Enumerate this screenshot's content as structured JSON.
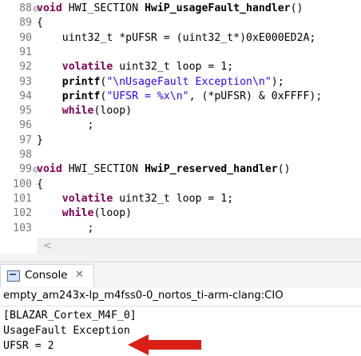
{
  "editor": {
    "lines": [
      {
        "num": "88",
        "fold": "⊖",
        "segments": [
          {
            "t": "void",
            "c": "kw"
          },
          {
            "t": " HWI_SECTION "
          },
          {
            "t": "HwiP_usageFault_handler",
            "c": "fn"
          },
          {
            "t": "()"
          }
        ]
      },
      {
        "num": "89",
        "fold": "",
        "segments": [
          {
            "t": "{"
          }
        ]
      },
      {
        "num": "90",
        "fold": "",
        "segments": [
          {
            "t": "    uint32_t *pUFSR = (uint32_t*)0xE000ED2A;"
          }
        ]
      },
      {
        "num": "91",
        "fold": "",
        "segments": []
      },
      {
        "num": "92",
        "fold": "",
        "segments": [
          {
            "t": "    "
          },
          {
            "t": "volatile",
            "c": "kw"
          },
          {
            "t": " uint32_t loop = 1;"
          }
        ]
      },
      {
        "num": "93",
        "fold": "",
        "segments": [
          {
            "t": "    "
          },
          {
            "t": "printf",
            "c": "fn"
          },
          {
            "t": "("
          },
          {
            "t": "\"\\nUsageFault Exception\\n\"",
            "c": "str"
          },
          {
            "t": ");"
          }
        ]
      },
      {
        "num": "94",
        "fold": "",
        "segments": [
          {
            "t": "    "
          },
          {
            "t": "printf",
            "c": "fn"
          },
          {
            "t": "("
          },
          {
            "t": "\"UFSR = %x\\n\"",
            "c": "str"
          },
          {
            "t": ", (*pUFSR) & 0xFFFF);"
          }
        ]
      },
      {
        "num": "95",
        "fold": "",
        "segments": [
          {
            "t": "    "
          },
          {
            "t": "while",
            "c": "kw"
          },
          {
            "t": "(loop)"
          }
        ]
      },
      {
        "num": "96",
        "fold": "",
        "segments": [
          {
            "t": "        ;"
          }
        ]
      },
      {
        "num": "97",
        "fold": "",
        "segments": [
          {
            "t": "}"
          }
        ]
      },
      {
        "num": "98",
        "fold": "",
        "segments": []
      },
      {
        "num": "99",
        "fold": "⊖",
        "segments": [
          {
            "t": "void",
            "c": "kw"
          },
          {
            "t": " HWI_SECTION "
          },
          {
            "t": "HwiP_reserved_handler",
            "c": "fn"
          },
          {
            "t": "()"
          }
        ]
      },
      {
        "num": "100",
        "fold": "",
        "segments": [
          {
            "t": "{"
          }
        ]
      },
      {
        "num": "101",
        "fold": "",
        "segments": [
          {
            "t": "    "
          },
          {
            "t": "volatile",
            "c": "kw"
          },
          {
            "t": " uint32_t loop = 1;"
          }
        ]
      },
      {
        "num": "102",
        "fold": "",
        "segments": [
          {
            "t": "    "
          },
          {
            "t": "while",
            "c": "kw"
          },
          {
            "t": "(loop)"
          }
        ]
      },
      {
        "num": "103",
        "fold": "",
        "segments": [
          {
            "t": "        ;"
          }
        ]
      }
    ],
    "scroll_left_glyph": "<"
  },
  "console": {
    "tab_label": "Console",
    "tab_close_glyph": "✕",
    "icon": "console-icon",
    "subtitle": "empty_am243x-lp_m4fss0-0_nortos_ti-arm-clang:CIO",
    "output": [
      "[BLAZAR_Cortex_M4F_0]",
      "UsageFault Exception",
      "UFSR = 2"
    ],
    "arrow_color": "#d91e18"
  }
}
